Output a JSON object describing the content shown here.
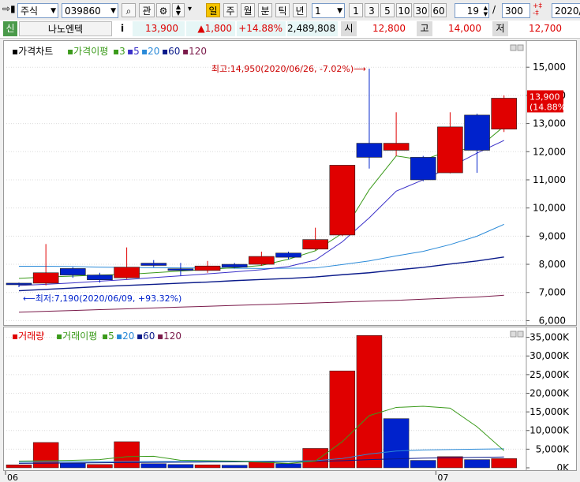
{
  "toolbar": {
    "market": "주식",
    "code": "039860",
    "btn_gwan": "관",
    "period_day": "일",
    "period_week": "주",
    "period_month": "월",
    "period_min": "분",
    "period_tick": "틱",
    "period_year": "년",
    "interval_value": "1",
    "interval_1": "1",
    "interval_3": "3",
    "interval_5": "5",
    "interval_10": "10",
    "interval_30": "30",
    "interval_60": "60",
    "count": "19",
    "slash": "/",
    "total": "300",
    "date": "2020/"
  },
  "quote": {
    "badge": "신",
    "name": "나노엔텍",
    "info_btn": "i",
    "price": "13,900",
    "change": "▲1,800",
    "change_pct": "+14.88%",
    "volume": "2,489,808",
    "open_label": "시",
    "open": "12,800",
    "high_label": "고",
    "high": "14,000",
    "low_label": "저",
    "low": "12,700"
  },
  "colors": {
    "up": "#e00000",
    "down": "#0022cc",
    "ma_gap": "#3a9a1a",
    "ma5": "#3a30c8",
    "ma20": "#2a8ad8",
    "ma60": "#0a1a8a",
    "ma120": "#7a1a4a"
  },
  "chart_data": [
    {
      "type": "candlestick",
      "title": "가격차트",
      "legend": [
        "가격이평",
        "3",
        "5",
        "20",
        "60",
        "120"
      ],
      "x_labels": [
        "06",
        "07"
      ],
      "y_ticks": [
        6000,
        7000,
        8000,
        9000,
        10000,
        11000,
        12000,
        13000,
        14000,
        15000
      ],
      "y_tick_labels": [
        "6,000",
        "7,000",
        "8,000",
        "9,000",
        "10,000",
        "11,000",
        "12,000",
        "13,000",
        "14,000",
        "15,000"
      ],
      "ylim": [
        5900,
        15650
      ],
      "candles": [
        {
          "o": 7330,
          "h": 7350,
          "l": 7190,
          "c": 7290
        },
        {
          "o": 7330,
          "h": 8720,
          "l": 7250,
          "c": 7700
        },
        {
          "o": 7850,
          "h": 7900,
          "l": 7520,
          "c": 7620
        },
        {
          "o": 7620,
          "h": 7700,
          "l": 7350,
          "c": 7450
        },
        {
          "o": 7520,
          "h": 8600,
          "l": 7480,
          "c": 7900
        },
        {
          "o": 8040,
          "h": 8150,
          "l": 7900,
          "c": 7960
        },
        {
          "o": 7840,
          "h": 8050,
          "l": 7600,
          "c": 7800
        },
        {
          "o": 7780,
          "h": 8120,
          "l": 7700,
          "c": 7940
        },
        {
          "o": 8000,
          "h": 8050,
          "l": 7850,
          "c": 7900
        },
        {
          "o": 8000,
          "h": 8450,
          "l": 7950,
          "c": 8280
        },
        {
          "o": 8400,
          "h": 8450,
          "l": 8170,
          "c": 8250
        },
        {
          "o": 8540,
          "h": 9300,
          "l": 8500,
          "c": 8880
        },
        {
          "o": 9040,
          "h": 11500,
          "l": 9000,
          "c": 11520
        },
        {
          "o": 12300,
          "h": 14950,
          "l": 11400,
          "c": 11800
        },
        {
          "o": 12050,
          "h": 13400,
          "l": 11850,
          "c": 12300
        },
        {
          "o": 11800,
          "h": 11850,
          "l": 10950,
          "c": 11000
        },
        {
          "o": 11250,
          "h": 13400,
          "l": 11230,
          "c": 12880
        },
        {
          "o": 13300,
          "h": 13350,
          "l": 11250,
          "c": 12050
        },
        {
          "o": 12800,
          "h": 14000,
          "l": 12700,
          "c": 13900
        }
      ],
      "ma_gap": [
        7500,
        7550,
        7580,
        7620,
        7640,
        7700,
        7760,
        7820,
        7880,
        7960,
        8180,
        8480,
        9100,
        10650,
        11850,
        11700,
        12050,
        12100,
        12900
      ],
      "ma5": [
        7250,
        7290,
        7340,
        7400,
        7460,
        7530,
        7590,
        7660,
        7730,
        7810,
        7920,
        8150,
        8800,
        9650,
        10600,
        11000,
        11450,
        11950,
        12400
      ],
      "ma20": [
        7930,
        7930,
        7920,
        7900,
        7890,
        7880,
        7870,
        7870,
        7860,
        7850,
        7860,
        7870,
        7990,
        8120,
        8300,
        8460,
        8700,
        9000,
        9420
      ],
      "ma60": [
        7060,
        7110,
        7160,
        7210,
        7250,
        7290,
        7330,
        7370,
        7420,
        7460,
        7500,
        7550,
        7630,
        7700,
        7800,
        7890,
        8010,
        8120,
        8260
      ],
      "ma120": [
        6300,
        6330,
        6360,
        6390,
        6420,
        6450,
        6480,
        6510,
        6540,
        6570,
        6600,
        6630,
        6660,
        6690,
        6720,
        6760,
        6800,
        6840,
        6900
      ],
      "annotations": {
        "high": "최고:14,950(2020/06/26, -7.02%)",
        "low": "최저:7,190(2020/06/09, +93.32%)",
        "price_tag": "13,900",
        "price_tag_pct": "(14.88%)"
      }
    },
    {
      "type": "bar",
      "title": "거래량",
      "legend": [
        "거래이평",
        "5",
        "20",
        "60",
        "120"
      ],
      "y_ticks": [
        0,
        5000,
        10000,
        15000,
        20000,
        25000,
        30000,
        35000
      ],
      "y_tick_labels": [
        "0K",
        "5,000K",
        "10,000K",
        "15,000K",
        "20,000K",
        "25,000K",
        "30,000K",
        "35,000K"
      ],
      "ylim": [
        0,
        36400
      ],
      "values": [
        800,
        6800,
        1200,
        900,
        7000,
        1100,
        900,
        800,
        700,
        1700,
        1100,
        5200,
        26000,
        35500,
        13200,
        2000,
        3000,
        2200,
        2490
      ],
      "up": [
        true,
        true,
        false,
        true,
        true,
        false,
        false,
        true,
        false,
        true,
        false,
        true,
        true,
        true,
        false,
        false,
        true,
        false,
        true
      ],
      "ma_gap": [
        1800,
        1900,
        2000,
        2200,
        3000,
        3100,
        2000,
        1900,
        1800,
        1500,
        1200,
        1800,
        7000,
        14000,
        16200,
        16500,
        16000,
        11000,
        4600
      ],
      "ma20": [
        1500,
        1550,
        1600,
        1650,
        1700,
        1700,
        1700,
        1720,
        1740,
        1760,
        1800,
        1900,
        2500,
        3700,
        4500,
        4800,
        4900,
        5000,
        5100
      ],
      "ma60": [
        1200,
        1250,
        1300,
        1350,
        1400,
        1450,
        1500,
        1550,
        1600,
        1650,
        1700,
        1750,
        1900,
        2200,
        2400,
        2600,
        2700,
        2800,
        2900
      ]
    }
  ]
}
